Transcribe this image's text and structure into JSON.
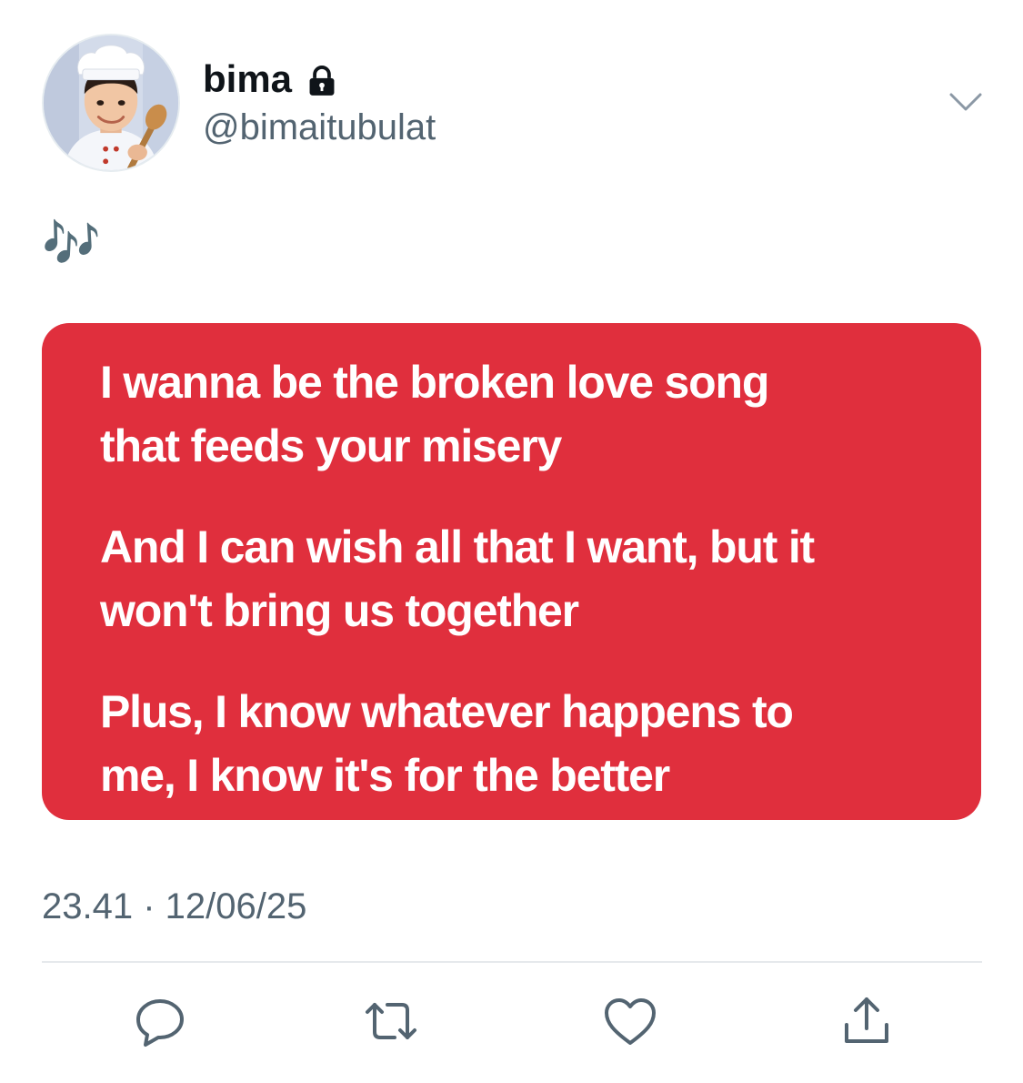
{
  "user": {
    "display_name": "bima",
    "handle": "@bimaitubulat"
  },
  "tweet": {
    "text": "🎶",
    "lyrics": [
      "I wanna be the broken love song\nthat feeds your misery",
      "And I can wish all that I want, but it\nwon't bring us together",
      "Plus, I know whatever happens to\nme, I know it's for the better"
    ],
    "lyrics_card_color": "#e02f3d",
    "timestamp": "23.41 · 12/06/25"
  },
  "icons": {
    "protected": "lock-icon",
    "more": "chevron-down-icon",
    "reply": "reply-icon",
    "retweet": "retweet-icon",
    "like": "heart-icon",
    "share": "share-icon"
  },
  "colors": {
    "text_primary": "#0f1419",
    "text_secondary": "#536471",
    "icon": "#536471",
    "divider": "#e6e9ec"
  }
}
